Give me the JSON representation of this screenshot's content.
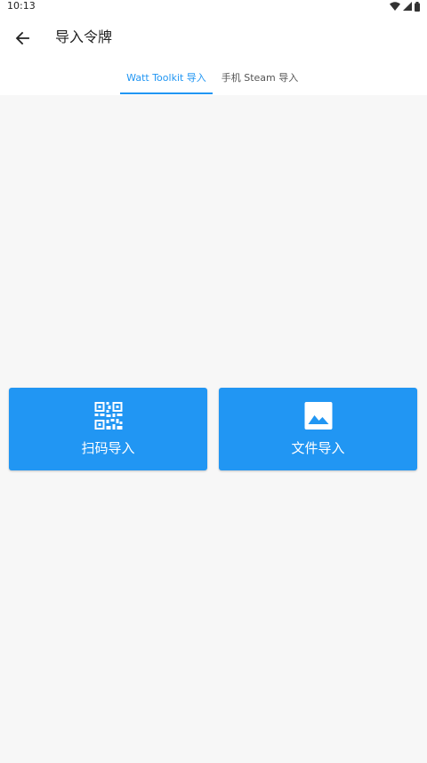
{
  "status": {
    "time": "10:13",
    "icons": [
      "wifi-icon",
      "signal-icon",
      "battery-icon"
    ]
  },
  "app_bar": {
    "title": "导入令牌",
    "back_icon": "arrow-left-icon"
  },
  "tabs": [
    {
      "label": "Watt Toolkit 导入",
      "selected": true
    },
    {
      "label": "手机 Steam 导入",
      "selected": false
    }
  ],
  "actions": [
    {
      "label": "扫码导入",
      "icon": "qr-code-icon"
    },
    {
      "label": "文件导入",
      "icon": "image-icon"
    }
  ],
  "colors": {
    "accent": "#2196f3",
    "background": "#f7f7f7",
    "surface": "#ffffff"
  }
}
